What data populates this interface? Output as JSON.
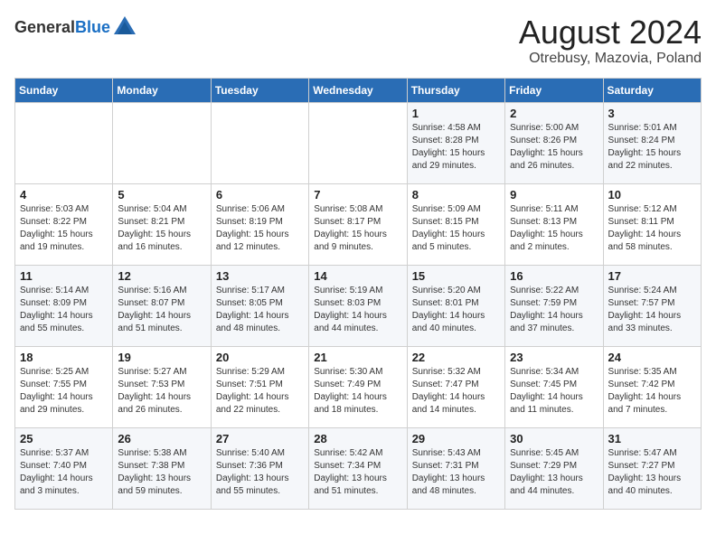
{
  "header": {
    "logo_general": "General",
    "logo_blue": "Blue",
    "month_year": "August 2024",
    "location": "Otrebusy, Mazovia, Poland"
  },
  "weekdays": [
    "Sunday",
    "Monday",
    "Tuesday",
    "Wednesday",
    "Thursday",
    "Friday",
    "Saturday"
  ],
  "weeks": [
    [
      {
        "day": "",
        "info": ""
      },
      {
        "day": "",
        "info": ""
      },
      {
        "day": "",
        "info": ""
      },
      {
        "day": "",
        "info": ""
      },
      {
        "day": "1",
        "info": "Sunrise: 4:58 AM\nSunset: 8:28 PM\nDaylight: 15 hours\nand 29 minutes."
      },
      {
        "day": "2",
        "info": "Sunrise: 5:00 AM\nSunset: 8:26 PM\nDaylight: 15 hours\nand 26 minutes."
      },
      {
        "day": "3",
        "info": "Sunrise: 5:01 AM\nSunset: 8:24 PM\nDaylight: 15 hours\nand 22 minutes."
      }
    ],
    [
      {
        "day": "4",
        "info": "Sunrise: 5:03 AM\nSunset: 8:22 PM\nDaylight: 15 hours\nand 19 minutes."
      },
      {
        "day": "5",
        "info": "Sunrise: 5:04 AM\nSunset: 8:21 PM\nDaylight: 15 hours\nand 16 minutes."
      },
      {
        "day": "6",
        "info": "Sunrise: 5:06 AM\nSunset: 8:19 PM\nDaylight: 15 hours\nand 12 minutes."
      },
      {
        "day": "7",
        "info": "Sunrise: 5:08 AM\nSunset: 8:17 PM\nDaylight: 15 hours\nand 9 minutes."
      },
      {
        "day": "8",
        "info": "Sunrise: 5:09 AM\nSunset: 8:15 PM\nDaylight: 15 hours\nand 5 minutes."
      },
      {
        "day": "9",
        "info": "Sunrise: 5:11 AM\nSunset: 8:13 PM\nDaylight: 15 hours\nand 2 minutes."
      },
      {
        "day": "10",
        "info": "Sunrise: 5:12 AM\nSunset: 8:11 PM\nDaylight: 14 hours\nand 58 minutes."
      }
    ],
    [
      {
        "day": "11",
        "info": "Sunrise: 5:14 AM\nSunset: 8:09 PM\nDaylight: 14 hours\nand 55 minutes."
      },
      {
        "day": "12",
        "info": "Sunrise: 5:16 AM\nSunset: 8:07 PM\nDaylight: 14 hours\nand 51 minutes."
      },
      {
        "day": "13",
        "info": "Sunrise: 5:17 AM\nSunset: 8:05 PM\nDaylight: 14 hours\nand 48 minutes."
      },
      {
        "day": "14",
        "info": "Sunrise: 5:19 AM\nSunset: 8:03 PM\nDaylight: 14 hours\nand 44 minutes."
      },
      {
        "day": "15",
        "info": "Sunrise: 5:20 AM\nSunset: 8:01 PM\nDaylight: 14 hours\nand 40 minutes."
      },
      {
        "day": "16",
        "info": "Sunrise: 5:22 AM\nSunset: 7:59 PM\nDaylight: 14 hours\nand 37 minutes."
      },
      {
        "day": "17",
        "info": "Sunrise: 5:24 AM\nSunset: 7:57 PM\nDaylight: 14 hours\nand 33 minutes."
      }
    ],
    [
      {
        "day": "18",
        "info": "Sunrise: 5:25 AM\nSunset: 7:55 PM\nDaylight: 14 hours\nand 29 minutes."
      },
      {
        "day": "19",
        "info": "Sunrise: 5:27 AM\nSunset: 7:53 PM\nDaylight: 14 hours\nand 26 minutes."
      },
      {
        "day": "20",
        "info": "Sunrise: 5:29 AM\nSunset: 7:51 PM\nDaylight: 14 hours\nand 22 minutes."
      },
      {
        "day": "21",
        "info": "Sunrise: 5:30 AM\nSunset: 7:49 PM\nDaylight: 14 hours\nand 18 minutes."
      },
      {
        "day": "22",
        "info": "Sunrise: 5:32 AM\nSunset: 7:47 PM\nDaylight: 14 hours\nand 14 minutes."
      },
      {
        "day": "23",
        "info": "Sunrise: 5:34 AM\nSunset: 7:45 PM\nDaylight: 14 hours\nand 11 minutes."
      },
      {
        "day": "24",
        "info": "Sunrise: 5:35 AM\nSunset: 7:42 PM\nDaylight: 14 hours\nand 7 minutes."
      }
    ],
    [
      {
        "day": "25",
        "info": "Sunrise: 5:37 AM\nSunset: 7:40 PM\nDaylight: 14 hours\nand 3 minutes."
      },
      {
        "day": "26",
        "info": "Sunrise: 5:38 AM\nSunset: 7:38 PM\nDaylight: 13 hours\nand 59 minutes."
      },
      {
        "day": "27",
        "info": "Sunrise: 5:40 AM\nSunset: 7:36 PM\nDaylight: 13 hours\nand 55 minutes."
      },
      {
        "day": "28",
        "info": "Sunrise: 5:42 AM\nSunset: 7:34 PM\nDaylight: 13 hours\nand 51 minutes."
      },
      {
        "day": "29",
        "info": "Sunrise: 5:43 AM\nSunset: 7:31 PM\nDaylight: 13 hours\nand 48 minutes."
      },
      {
        "day": "30",
        "info": "Sunrise: 5:45 AM\nSunset: 7:29 PM\nDaylight: 13 hours\nand 44 minutes."
      },
      {
        "day": "31",
        "info": "Sunrise: 5:47 AM\nSunset: 7:27 PM\nDaylight: 13 hours\nand 40 minutes."
      }
    ]
  ]
}
